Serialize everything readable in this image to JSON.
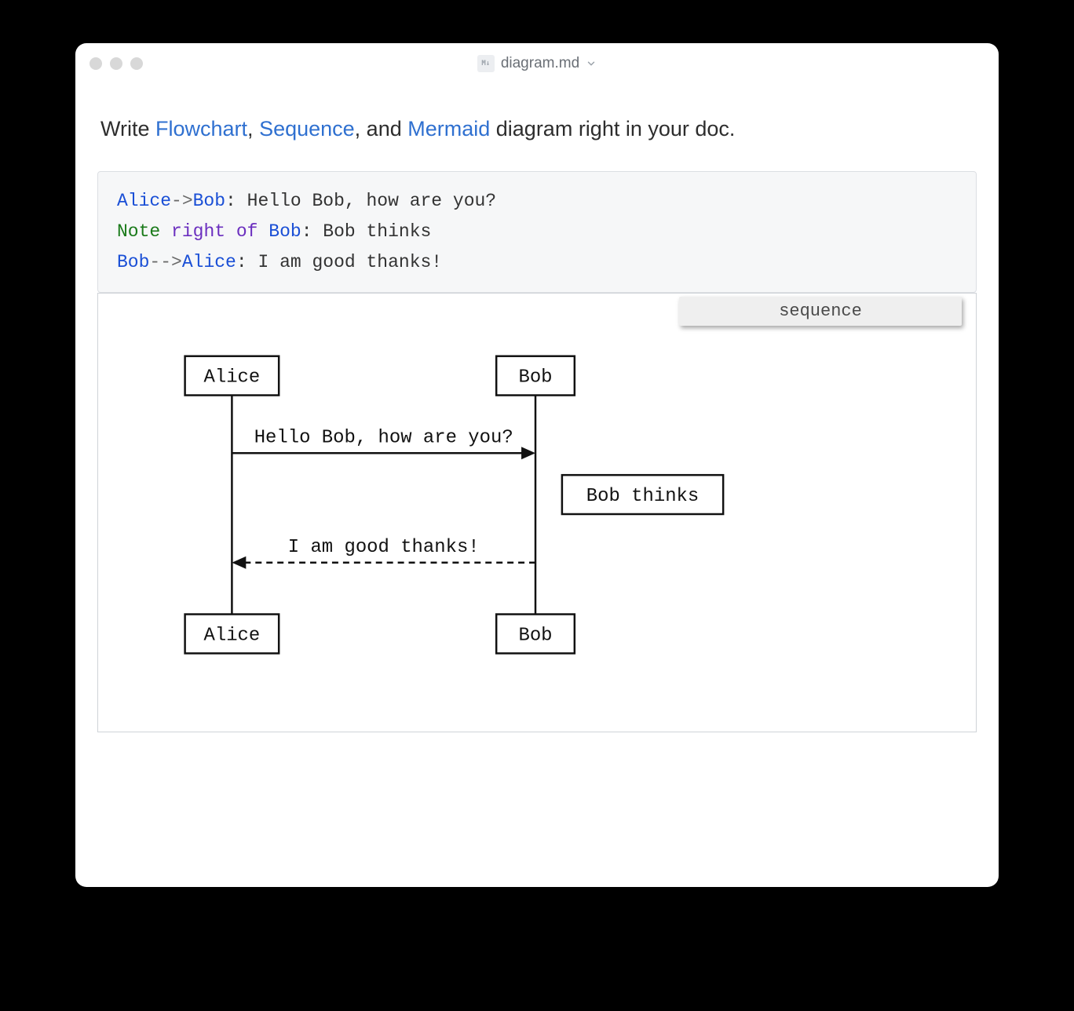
{
  "window": {
    "title": "diagram.md",
    "file_icon_label": "M↓"
  },
  "intro": {
    "lead": "Write ",
    "link1": "Flowchart",
    "sep1": ", ",
    "link2": "Sequence",
    "sep2": ", and ",
    "link3": "Mermaid",
    "tail": " diagram right in your doc."
  },
  "code": {
    "line1": {
      "from": "Alice",
      "arrow": "->",
      "to": "Bob",
      "colon": ": ",
      "text": "Hello Bob, how are you?"
    },
    "line2": {
      "kw1": "Note",
      "sp1": " ",
      "kw2": "right of",
      "sp2": " ",
      "name": "Bob",
      "colon": ": ",
      "text": "Bob thinks"
    },
    "line3": {
      "from": "Bob",
      "arrow": "-->",
      "to": "Alice",
      "colon": ": ",
      "text": "I am good thanks!"
    }
  },
  "diagram": {
    "type_label": "sequence",
    "actors": {
      "a": "Alice",
      "b": "Bob"
    },
    "msg1": "Hello Bob, how are you?",
    "note": "Bob thinks",
    "msg2": "I am good thanks!"
  }
}
